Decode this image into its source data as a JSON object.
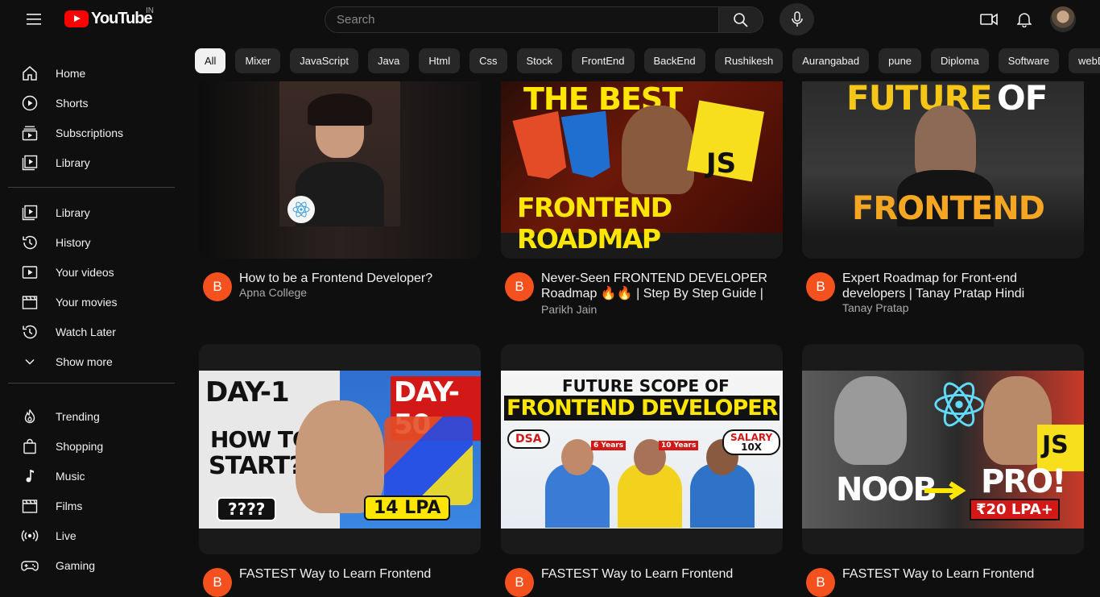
{
  "header": {
    "logo_text": "YouTube",
    "region": "IN",
    "search_placeholder": "Search"
  },
  "chips": [
    "All",
    "Mixer",
    "JavaScript",
    "Java",
    "Html",
    "Css",
    "Stock",
    "FrontEnd",
    "BackEnd",
    "Rushikesh",
    "Aurangabad",
    "pune",
    "Diploma",
    "Software",
    "webDev"
  ],
  "sidebar": {
    "group1": [
      {
        "label": "Home",
        "icon": "home-icon"
      },
      {
        "label": "Shorts",
        "icon": "shorts-icon"
      },
      {
        "label": "Subscriptions",
        "icon": "subscriptions-icon"
      },
      {
        "label": "Library",
        "icon": "library-icon"
      }
    ],
    "group2": [
      {
        "label": "Library",
        "icon": "library-icon"
      },
      {
        "label": "History",
        "icon": "history-icon"
      },
      {
        "label": "Your videos",
        "icon": "your-videos-icon"
      },
      {
        "label": "Your movies",
        "icon": "movies-icon"
      },
      {
        "label": "Watch Later",
        "icon": "watch-later-icon"
      },
      {
        "label": "Show more",
        "icon": "chevron-down-icon"
      }
    ],
    "group3": [
      {
        "label": "Trending",
        "icon": "trending-icon"
      },
      {
        "label": "Shopping",
        "icon": "shopping-icon"
      },
      {
        "label": "Music",
        "icon": "music-icon"
      },
      {
        "label": "Films",
        "icon": "films-icon"
      },
      {
        "label": "Live",
        "icon": "live-icon"
      },
      {
        "label": "Gaming",
        "icon": "gaming-icon"
      }
    ]
  },
  "videos": [
    {
      "avatar": "B",
      "title": "How to be a Frontend Developer?",
      "channel": "Apna College"
    },
    {
      "avatar": "B",
      "title": "Never-Seen FRONTEND DEVELOPER Roadmap 🔥🔥 | Step By Step Guide |",
      "channel": "Parikh Jain",
      "thumb_top": "THE BEST",
      "thumb_bottom": "FRONTEND ROADMAP",
      "thumb_badge": "JS"
    },
    {
      "avatar": "B",
      "title": "Expert Roadmap for Front-end developers | Tanay Pratap Hindi",
      "channel": "Tanay Pratap",
      "thumb_top1": "FUTURE",
      "thumb_top2": "OF",
      "thumb_bottom": "FRONTEND"
    },
    {
      "avatar": "B",
      "title": "FASTEST Way to Learn Frontend",
      "thumb_day1": "DAY-1",
      "thumb_day50": "DAY-50",
      "thumb_q1": "HOW TO",
      "thumb_q2": "START?",
      "thumb_marks": "????",
      "thumb_lpa": "14 LPA"
    },
    {
      "avatar": "B",
      "title": "FASTEST Way to Learn Frontend",
      "thumb_top": "FUTURE SCOPE OF",
      "thumb_mid": "FRONTEND DEVELOPER",
      "thumb_dsa": "DSA",
      "thumb_salary": "SALARY",
      "thumb_10x": "10X",
      "thumb_years1": "6 Years",
      "thumb_years2": "10 Years"
    },
    {
      "avatar": "B",
      "title": "FASTEST Way to Learn Frontend",
      "thumb_noob": "NOOB",
      "thumb_pro": "PRO!",
      "thumb_lpa": "₹20 LPA+",
      "thumb_badge": "JS"
    }
  ]
}
